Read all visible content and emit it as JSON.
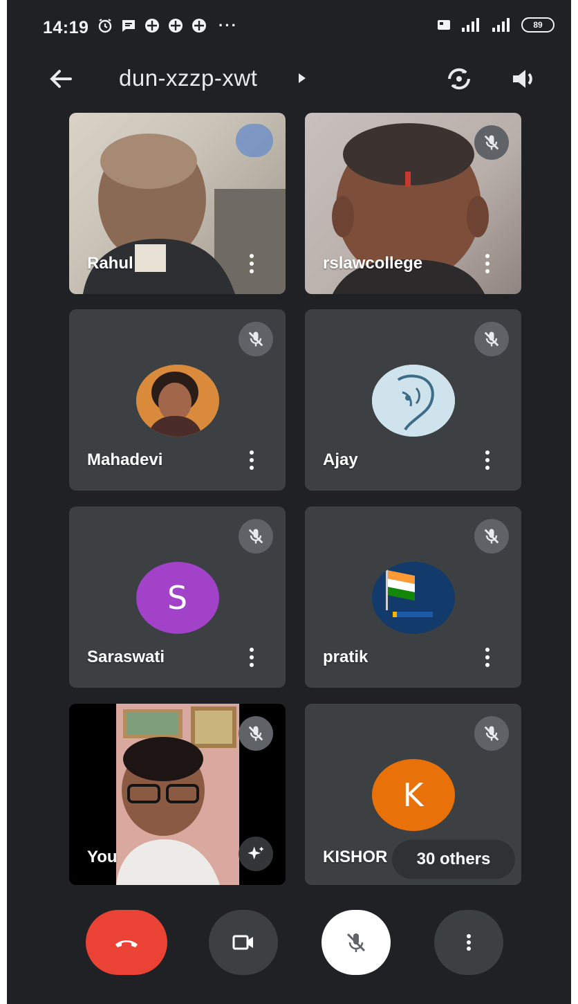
{
  "status_bar": {
    "time": "14:19",
    "more_notifications": "···",
    "battery": "89"
  },
  "header": {
    "meeting_code": "dun-xzzp-xwt"
  },
  "participants": [
    {
      "name": "Rahul",
      "kind": "video"
    },
    {
      "name": "rslawcollege",
      "kind": "video"
    },
    {
      "name": "Mahadevi",
      "kind": "photo"
    },
    {
      "name": "Ajay",
      "kind": "photo"
    },
    {
      "name": "Saraswati",
      "kind": "letter",
      "initial": "S",
      "color": "#a142c8"
    },
    {
      "name": "pratik",
      "kind": "photo"
    },
    {
      "name": "You",
      "kind": "self-video"
    },
    {
      "name": "KISHOR",
      "kind": "letter",
      "initial": "K",
      "color": "#e8710a"
    }
  ],
  "others_chip": "30 others",
  "colors": {
    "background": "#202124",
    "tile": "#3c4043",
    "end_call": "#ea4335",
    "control": "#3c4043",
    "mic_active_bg": "#ffffff"
  },
  "icons": [
    "back-arrow-icon",
    "switch-camera-icon",
    "speaker-icon",
    "mic-off-icon",
    "more-vert-icon",
    "end-call-icon",
    "camera-icon",
    "effects-sparkle-icon"
  ]
}
